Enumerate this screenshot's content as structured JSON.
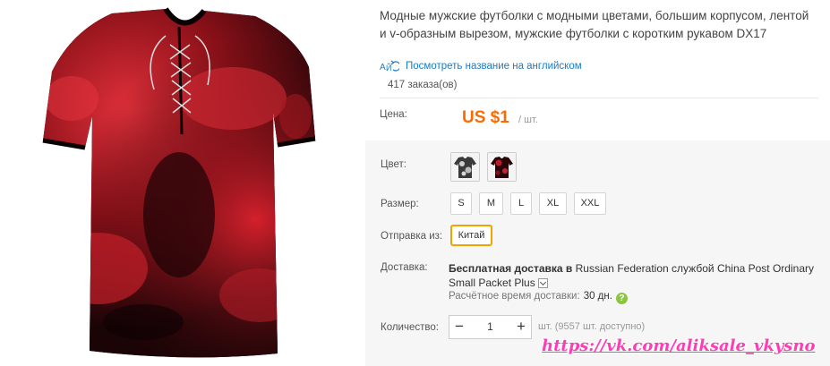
{
  "product": {
    "title": "Модные мужские футболки с модными цветами, большим корпусом, лентой и v-образным вырезом, мужские футболки с коротким рукавом DX17",
    "translate_link": "Посмотреть название на английском",
    "orders": "417 заказа(ов)"
  },
  "price": {
    "label": "Цена:",
    "value": "US $1",
    "unit": "/ шт."
  },
  "color": {
    "label": "Цвет:",
    "swatches": [
      "white-black-tie-dye",
      "black-red-tie-dye"
    ]
  },
  "size": {
    "label": "Размер:",
    "options": [
      "S",
      "M",
      "L",
      "XL",
      "XXL"
    ]
  },
  "ship_from": {
    "label": "Отправка из:",
    "selected": "Китай"
  },
  "delivery": {
    "label": "Доставка:",
    "free_text": "Бесплатная доставка в",
    "destination": "Russian Federation",
    "service_prefix": "службой",
    "service": "China Post Ordinary Small Packet Plus",
    "eta_label": "Расчётное время доставки:",
    "eta_value": "30 дн."
  },
  "quantity": {
    "label": "Количество:",
    "value": "1",
    "minus": "−",
    "plus": "+",
    "available": "шт. (9557 шт. доступно)"
  },
  "watermark": "https://vk.com/aliksale_vkysno",
  "colors": {
    "accent": "#ff6a00",
    "link": "#1a7bc4",
    "selected_border": "#f0a400",
    "watermark": "#ff3bb8"
  }
}
